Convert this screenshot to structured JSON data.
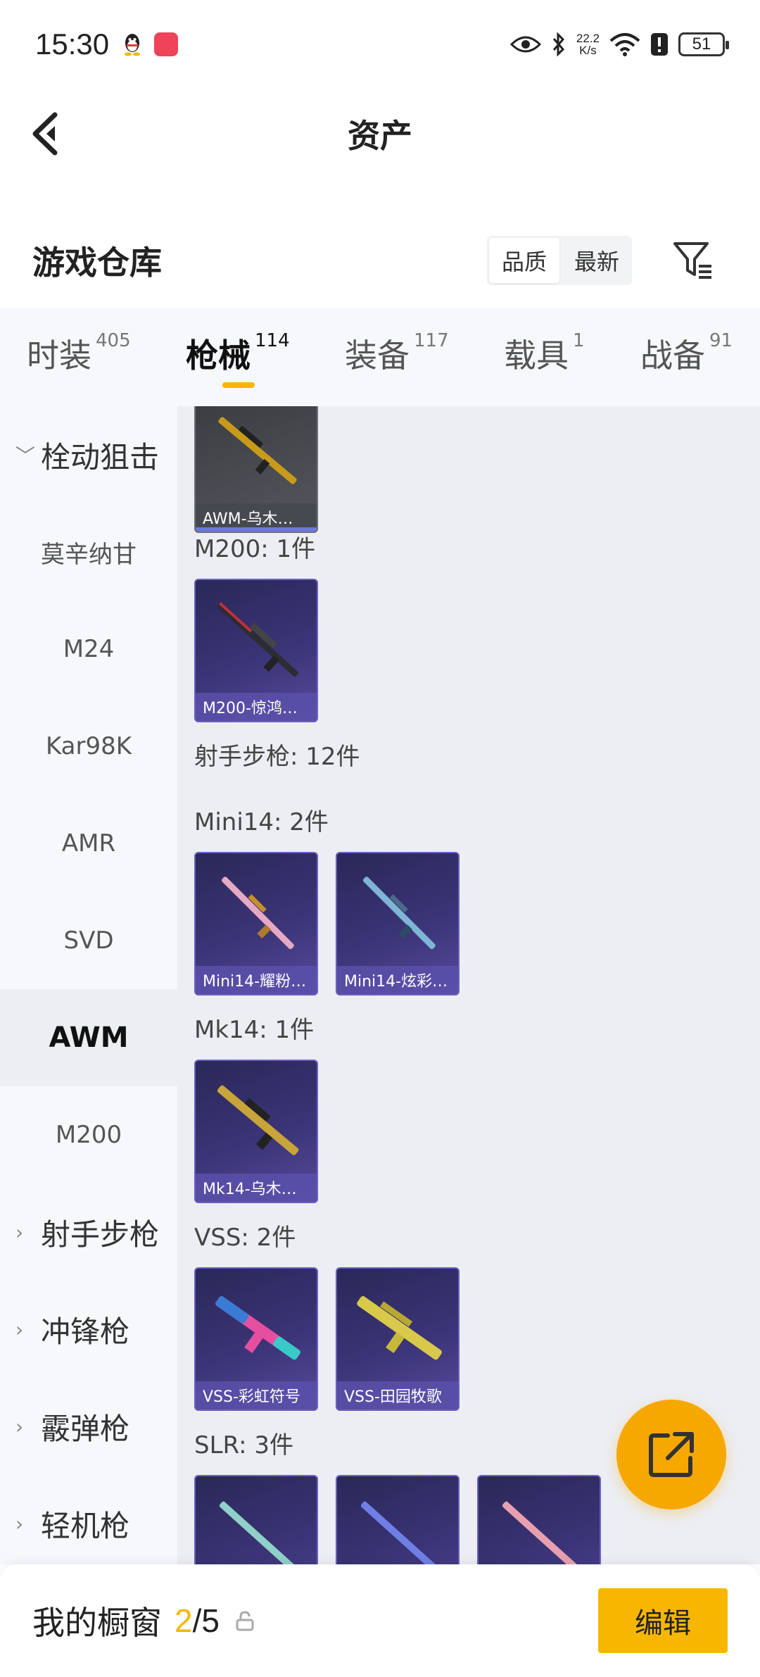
{
  "status_bar": {
    "time": "15:30",
    "speed_value": "22.2",
    "speed_unit": "K/s",
    "battery": "51"
  },
  "header": {
    "title": "资产"
  },
  "warehouse": {
    "title": "游戏仓库",
    "sort_options": [
      "品质",
      "最新"
    ],
    "active_sort": "品质"
  },
  "category_tabs": [
    {
      "label": "时装",
      "count": "405"
    },
    {
      "label": "枪械",
      "count": "114",
      "active": true
    },
    {
      "label": "装备",
      "count": "117"
    },
    {
      "label": "载具",
      "count": "1"
    },
    {
      "label": "战备",
      "count": "91"
    }
  ],
  "sidebar": {
    "items": [
      {
        "label": "栓动狙击",
        "type": "group-open"
      },
      {
        "label": "莫辛纳甘"
      },
      {
        "label": "M24"
      },
      {
        "label": "Kar98K"
      },
      {
        "label": "AMR"
      },
      {
        "label": "SVD"
      },
      {
        "label": "AWM",
        "active": true
      },
      {
        "label": "M200"
      },
      {
        "label": "射手步枪",
        "type": "group"
      },
      {
        "label": "冲锋枪",
        "type": "group"
      },
      {
        "label": "霰弹枪",
        "type": "group"
      },
      {
        "label": "轻机枪",
        "type": "group"
      }
    ]
  },
  "content": {
    "sections": {
      "m200": "M200: 1件",
      "dmr": "射手步枪: 12件",
      "mini14": "Mini14: 2件",
      "mk14": "Mk14: 1件",
      "vss": "VSS: 2件",
      "slr": "SLR: 3件"
    },
    "cards": {
      "awm": "AWM-乌木…",
      "m200": "M200-惊鸿…",
      "mini14_a": "Mini14-耀粉…",
      "mini14_b": "Mini14-炫彩…",
      "mk14": "Mk14-乌木…",
      "vss_a": "VSS-彩虹符号",
      "vss_b": "VSS-田园牧歌"
    }
  },
  "bottom_bar": {
    "label": "我的橱窗",
    "current": "2",
    "total": "/5",
    "edit_label": "编辑"
  },
  "colors": {
    "accent": "#f7b600",
    "fab": "#f7a800",
    "card_bg": "#3b3477"
  }
}
